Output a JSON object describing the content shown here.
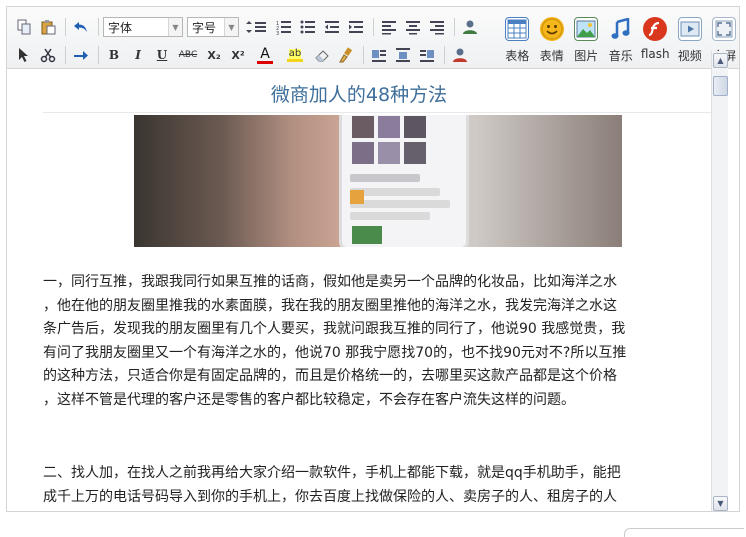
{
  "toolbar": {
    "font_combo": "字体",
    "size_combo": "字号",
    "big_buttons": [
      {
        "label": "表格",
        "color": "#4a7fc1"
      },
      {
        "label": "表情",
        "color": "#f2b318"
      },
      {
        "label": "图片",
        "color": "#3f9f4a"
      },
      {
        "label": "音乐",
        "color": "#3b78c6"
      },
      {
        "label": "flash",
        "color": "#e0401e"
      },
      {
        "label": "视频",
        "color": "#6c8fb8"
      },
      {
        "label": "全屏",
        "color": "#8da3bf"
      }
    ],
    "bold": "B",
    "italic": "I",
    "underline": "U",
    "strike": "ABC",
    "subscript": "X₂",
    "superscript": "X²",
    "fontcolor": "A",
    "highlight": "ab"
  },
  "document": {
    "title": "微商加人的48种方法",
    "paragraph1_lines": [
      " 一，同行互推，我跟我同行如果互推的话商，假如他是卖另一个品牌的化妆品，比如海洋之水",
      "，他在他的朋友圈里推我的水素面膜，我在我的朋友圈里推他的海洋之水，我发完海洋之水这",
      "条广告后，发现我的朋友圈里有几个人要买，我就问跟我互推的同行了，他说90 我感觉贵，我",
      "有问了我朋友圈里又一个有海洋之水的，他说70 那我宁愿找70的，也不找90元对不?所以互推",
      "的这种方法，只适合你是有固定品牌的，而且是价格统一的，去哪里买这款产品都是这个价格",
      "，这样不管是代理的客户还是零售的客户都比较稳定，不会存在客户流失这样的问题。"
    ],
    "paragraph2_lines": [
      "二、找人加，在找人之前我再给大家介绍一款软件，手机上都能下载，就是qq手机助手，能把",
      "成千上万的电话号码导入到你的手机上，你去百度上找做保险的人、卖房子的人、租房子的人"
    ]
  }
}
